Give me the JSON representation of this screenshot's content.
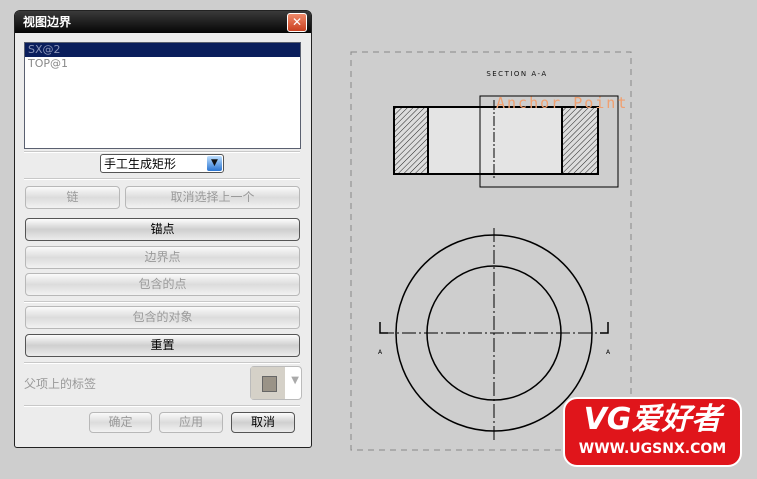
{
  "dialog": {
    "title": "视图边界",
    "list": [
      "SX@2",
      "TOP@1"
    ],
    "mode": "手工生成矩形",
    "chain": "链",
    "deselect": "取消选择上一个",
    "anchor": "锚点",
    "boundary_point": "边界点",
    "contained_points": "包含的点",
    "contained_objects": "包含的对象",
    "reset": "重置",
    "parent_label": "父项上的标签",
    "ok": "确定",
    "apply": "应用",
    "cancel": "取消"
  },
  "drawing": {
    "section_title": "SECTION A-A",
    "anchor_label": "Anchor Point",
    "section_mark": "A",
    "anchor_color": "#f0a070"
  },
  "watermark": {
    "title": "VG爱好者",
    "url": "WWW.UGSNX.COM"
  }
}
